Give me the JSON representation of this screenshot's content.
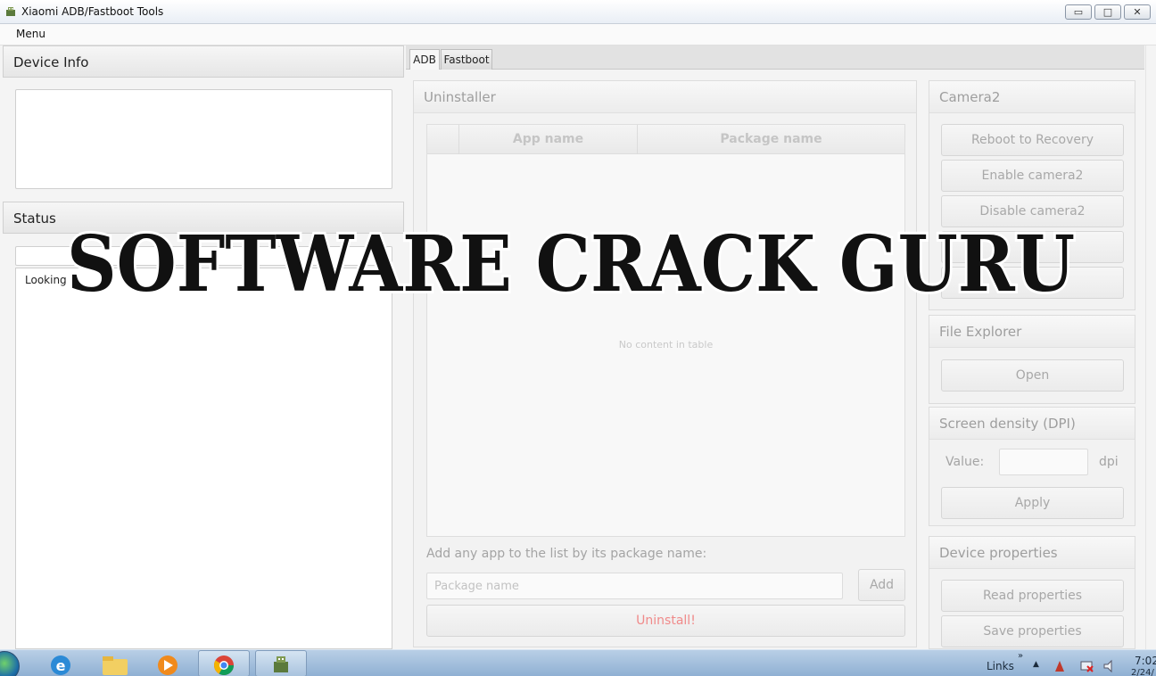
{
  "window": {
    "title": "Xiaomi ADB/Fastboot Tools"
  },
  "menubar": {
    "menu": "Menu"
  },
  "left": {
    "device_info": "Device Info",
    "status": "Status",
    "status_text": "Looking"
  },
  "tabs": [
    {
      "label": "ADB"
    },
    {
      "label": "Fastboot"
    }
  ],
  "uninstaller": {
    "title": "Uninstaller",
    "columns": [
      "",
      "App name",
      "Package name"
    ],
    "empty_text": "No content in table",
    "add_label": "Add any app to the list by its package name:",
    "package_placeholder": "Package name",
    "add_button": "Add",
    "uninstall_button": "Uninstall!"
  },
  "camera2": {
    "title": "Camera2",
    "buttons": [
      "Reboot to Recovery",
      "Enable camera2",
      "Disable camera2",
      "",
      ""
    ]
  },
  "file_explorer": {
    "title": "File Explorer",
    "open_button": "Open"
  },
  "screen_density": {
    "title": "Screen density (DPI)",
    "value_label": "Value:",
    "unit": "dpi",
    "apply_button": "Apply"
  },
  "device_properties": {
    "title": "Device properties",
    "read_button": "Read properties",
    "save_button": "Save properties"
  },
  "watermark": {
    "text": "SOFTWARE CRACK GURU"
  },
  "taskbar": {
    "links": "Links",
    "chevron": "»",
    "tray_arrow": "▲",
    "time": "7:02",
    "date": "2/24/"
  },
  "icons": {
    "app": "app-robot-icon",
    "minimize": "minimize-icon",
    "maximize": "maximize-icon",
    "close": "close-icon"
  },
  "colors": {
    "uninstall_text": "#f08a8a",
    "taskbar": "#a9c3de"
  }
}
